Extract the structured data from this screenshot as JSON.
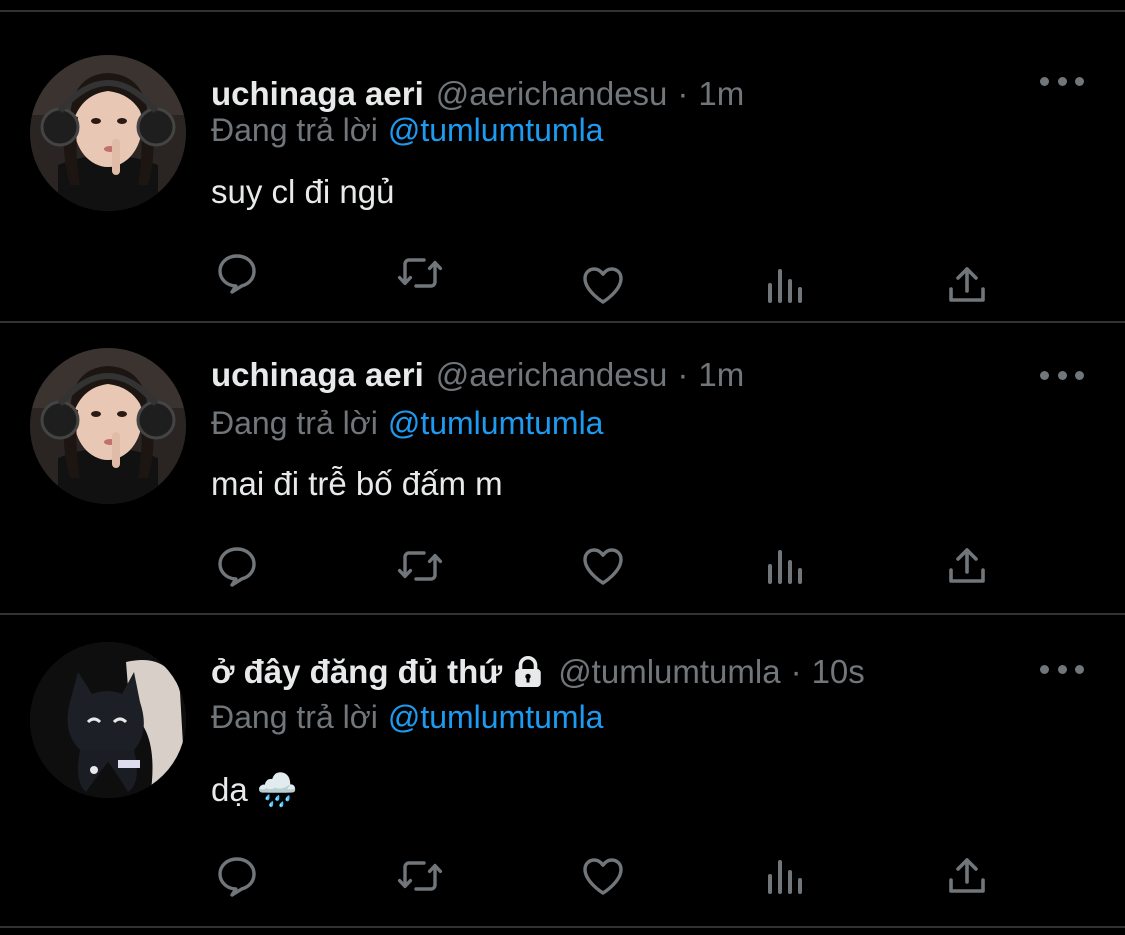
{
  "tweets": [
    {
      "name": "uchinaga aeri",
      "handle": "@aerichandesu",
      "separator": "·",
      "time": "1m",
      "reply_prefix": "Đang trả lời",
      "reply_to": "@tumlumtumla",
      "text": "suy cl đi ngủ",
      "avatar": "woman-with-headphones-avatar",
      "protected": false
    },
    {
      "name": "uchinaga aeri",
      "handle": "@aerichandesu",
      "separator": "·",
      "time": "1m",
      "reply_prefix": "Đang trả lời",
      "reply_to": "@tumlumtumla",
      "text": "mai đi trễ bố đấm m",
      "avatar": "woman-with-headphones-avatar",
      "protected": false
    },
    {
      "name": "ở đây đăng đủ thứ",
      "handle": "@tumlumtumla",
      "separator": "·",
      "time": "10s",
      "reply_prefix": "Đang trả lời",
      "reply_to": "@tumlumtumla",
      "text": "dạ 🌧️",
      "avatar": "black-cat-plush-avatar",
      "protected": true
    }
  ],
  "icons": {
    "reply": "speech-bubble-icon",
    "retweet": "retweet-icon",
    "like": "heart-icon",
    "views": "bar-chart-icon",
    "share": "share-upload-icon",
    "more": "more-dots-icon",
    "lock": "lock-icon"
  },
  "colors": {
    "background": "#000000",
    "text": "#e7e9ea",
    "muted": "#71767b",
    "link": "#1d9bf0",
    "divider": "#2f3336"
  }
}
